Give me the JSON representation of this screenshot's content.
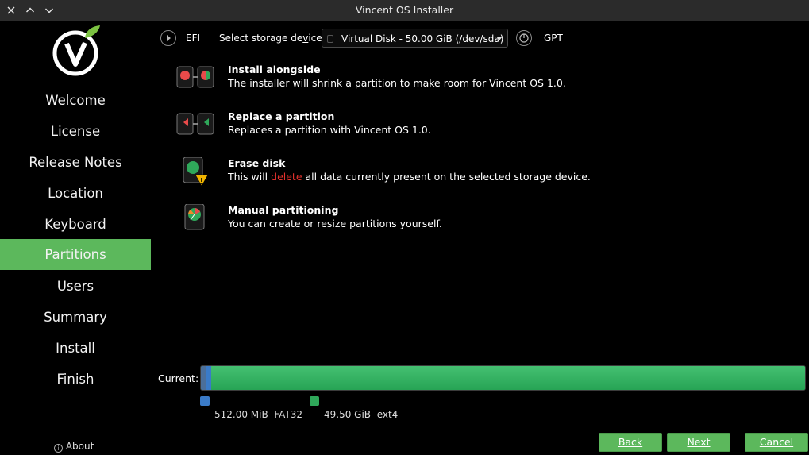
{
  "window": {
    "title": "Vincent OS Installer",
    "controls": [
      "close-icon",
      "maximize-icon",
      "minimize-icon"
    ]
  },
  "sidebar": {
    "items": [
      {
        "label": "Welcome"
      },
      {
        "label": "License"
      },
      {
        "label": "Release Notes"
      },
      {
        "label": "Location"
      },
      {
        "label": "Keyboard"
      },
      {
        "label": "Partitions",
        "active": true
      },
      {
        "label": "Users"
      },
      {
        "label": "Summary"
      },
      {
        "label": "Install"
      },
      {
        "label": "Finish"
      }
    ],
    "about": "About",
    "active_color": "#5cb85c"
  },
  "storage": {
    "firmware": "EFI",
    "device_label_pre": "Select storage de",
    "device_label_accel": "v",
    "device_label_post": "ice:",
    "selected_device": "Virtual Disk - 50.00 GiB (/dev/sda)",
    "partition_table": "GPT"
  },
  "options": [
    {
      "title": "Install alongside",
      "desc": "The installer will shrink a partition to make room for Vincent OS 1.0."
    },
    {
      "title": "Replace a partition",
      "desc": "Replaces a partition with Vincent OS 1.0."
    },
    {
      "title": "Erase disk",
      "desc_pre": "This will ",
      "desc_highlight": "delete",
      "desc_post": " all data currently present on the selected storage device."
    },
    {
      "title": "Manual partitioning",
      "desc": "You can create or resize partitions yourself."
    }
  ],
  "partition_bar": {
    "label": "Current:",
    "segments": [
      {
        "size": "512.00 MiB",
        "fs": "FAT32",
        "color": "#3a7bc8",
        "fraction": 0.01
      },
      {
        "size": "49.50 GiB",
        "fs": "ext4",
        "color": "#2fa85a",
        "fraction": 0.99
      }
    ]
  },
  "buttons": {
    "back": "Back",
    "next": "Next",
    "cancel": "Cancel"
  }
}
